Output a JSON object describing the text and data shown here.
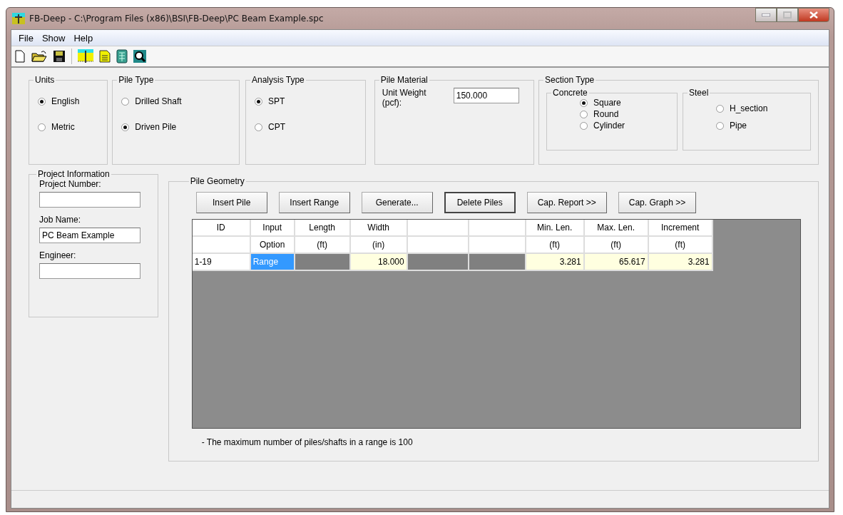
{
  "window": {
    "title": "FB-Deep - C:\\Program Files (x86)\\BSI\\FB-Deep\\PC Beam Example.spc"
  },
  "menu": [
    "File",
    "Show",
    "Help"
  ],
  "toolbar": [
    {
      "kind": "new"
    },
    {
      "kind": "open"
    },
    {
      "kind": "save"
    },
    {
      "kind": "separator"
    },
    {
      "kind": "pile"
    },
    {
      "kind": "report"
    },
    {
      "kind": "calculator"
    },
    {
      "kind": "search"
    }
  ],
  "units": {
    "title": "Units",
    "options": [
      {
        "label": "English",
        "selected": true
      },
      {
        "label": "Metric",
        "selected": false
      }
    ]
  },
  "pile_type": {
    "title": "Pile Type",
    "options": [
      {
        "label": "Drilled Shaft",
        "selected": false
      },
      {
        "label": "Driven Pile",
        "selected": true
      }
    ]
  },
  "analysis_type": {
    "title": "Analysis Type",
    "options": [
      {
        "label": "SPT",
        "selected": true
      },
      {
        "label": "CPT",
        "selected": false
      }
    ]
  },
  "pile_material": {
    "title": "Pile Material",
    "label": "Unit Weight (pcf):",
    "value": "150.000"
  },
  "section_type": {
    "title": "Section Type",
    "concrete": {
      "title": "Concrete",
      "options": [
        {
          "label": "Square",
          "selected": true
        },
        {
          "label": "Round",
          "selected": false
        },
        {
          "label": "Cylinder",
          "selected": false
        }
      ]
    },
    "steel": {
      "title": "Steel",
      "options": [
        {
          "label": "H_section",
          "selected": false
        },
        {
          "label": "Pipe",
          "selected": false
        }
      ]
    }
  },
  "project_information": {
    "title": "Project Information",
    "fields": [
      {
        "label": "Project Number:"
      },
      {
        "label": "Job Name:",
        "value": "PC Beam Example"
      },
      {
        "label": "Engineer:"
      }
    ]
  },
  "pile_geometry": {
    "title": "Pile Geometry",
    "buttons": [
      {
        "label": "Insert Pile",
        "default": false
      },
      {
        "label": "Insert Range",
        "default": false
      },
      {
        "label": "Generate...",
        "default": false
      },
      {
        "label": "Delete Piles",
        "default": true
      },
      {
        "label": "Cap. Report >>",
        "default": false
      },
      {
        "label": "Cap. Graph >>",
        "default": false
      }
    ],
    "columns": [
      {
        "kind": "header",
        "line1": "ID"
      },
      {
        "kind": "header",
        "line1": "Input",
        "line2": "Option"
      },
      {
        "kind": "header",
        "line1": "Length",
        "line2": "(ft)"
      },
      {
        "kind": "header",
        "line1": "Width",
        "line2": "(in)"
      },
      {
        "kind": "blank"
      },
      {
        "kind": "blank"
      },
      {
        "kind": "header",
        "line1": "Min. Len.",
        "line2": "(ft)"
      },
      {
        "kind": "header",
        "line1": "Max. Len.",
        "line2": "(ft)"
      },
      {
        "kind": "header",
        "line1": "Increment",
        "line2": "(ft)"
      }
    ],
    "rows": [
      [
        {
          "kind": "id",
          "text": "1-19"
        },
        {
          "kind": "selected",
          "text": "Range"
        },
        {
          "kind": "disabled"
        },
        {
          "kind": "number",
          "text": "18.000"
        },
        {
          "kind": "disabled"
        },
        {
          "kind": "disabled"
        },
        {
          "kind": "number",
          "text": "3.281"
        },
        {
          "kind": "number",
          "text": "65.617"
        },
        {
          "kind": "number",
          "text": "3.281"
        }
      ]
    ],
    "note": "- The maximum number of piles/shafts in a range is 100"
  }
}
